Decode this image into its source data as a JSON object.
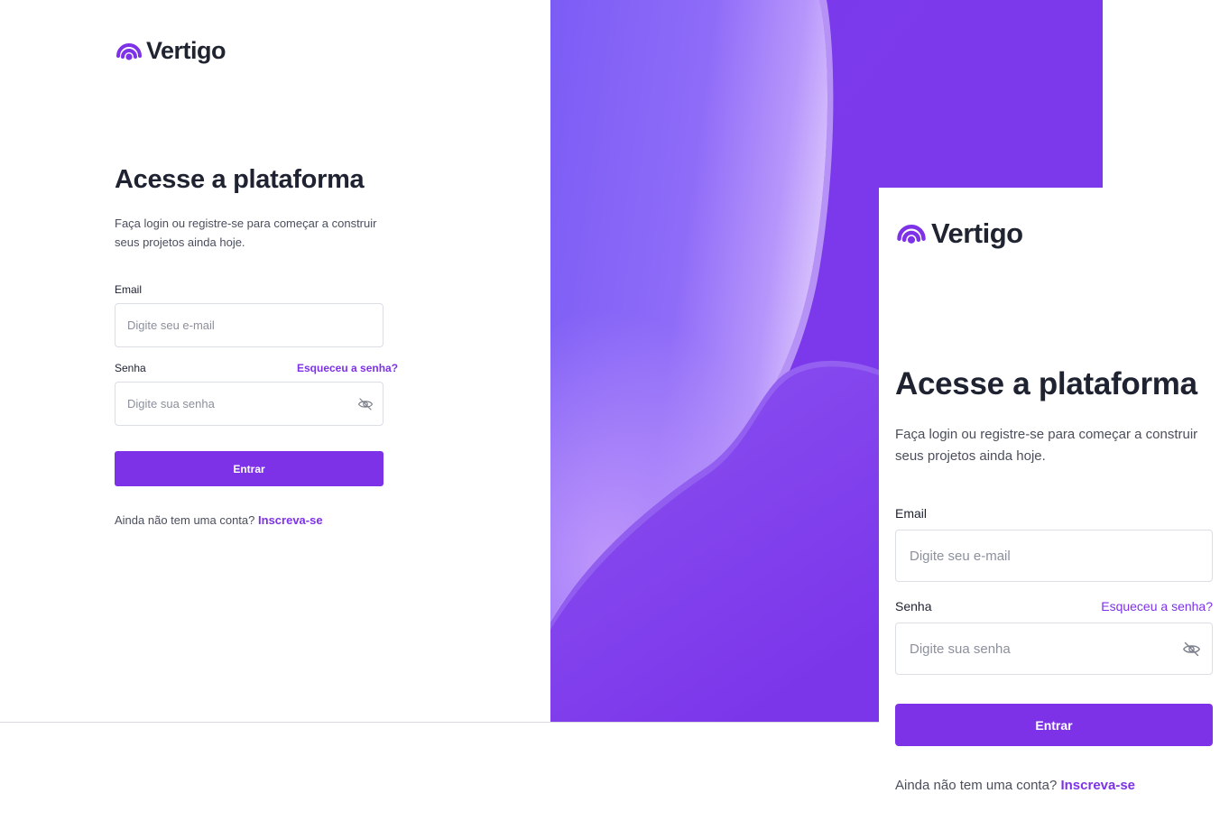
{
  "brand": {
    "name": "Vertigo"
  },
  "colors": {
    "accent": "#7e32e8",
    "heading": "#1f2331",
    "hero_bg": "#7c3aed"
  },
  "desktop": {
    "title": "Acesse a plataforma",
    "subtitle": "Faça login ou registre-se para começar a construir seus projetos ainda hoje.",
    "email_label": "Email",
    "email_placeholder": "Digite seu e-mail",
    "password_label": "Senha",
    "forgot_link": "Esqueceu a senha?",
    "password_placeholder": "Digite sua senha",
    "submit_label": "Entrar",
    "signup_prompt": "Ainda não tem uma conta?",
    "signup_link": "Inscreva-se"
  },
  "mobile": {
    "title": "Acesse a plataforma",
    "subtitle": "Faça login ou registre-se para começar a construir seus projetos ainda hoje.",
    "email_label": "Email",
    "email_placeholder": "Digite seu e-mail",
    "password_label": "Senha",
    "forgot_link": "Esqueceu a senha?",
    "password_placeholder": "Digite sua senha",
    "submit_label": "Entrar",
    "signup_prompt": "Ainda não tem uma conta?",
    "signup_link": "Inscreva-se"
  },
  "icons": {
    "logo": "vertigo-logo-icon",
    "password_toggle": "eye-off-icon"
  }
}
